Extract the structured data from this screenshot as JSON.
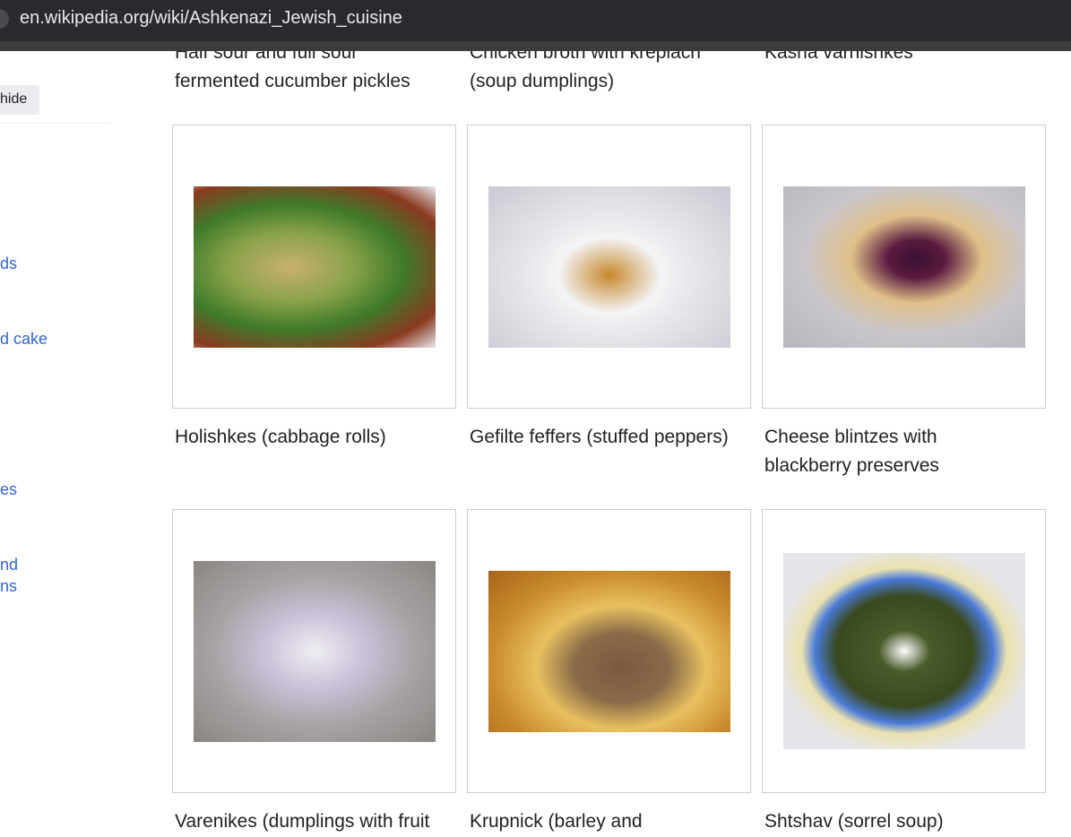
{
  "browser": {
    "url": "en.wikipedia.org/wiki/Ashkenazi_Jewish_cuisine"
  },
  "sidebar": {
    "hide_label": "hide",
    "toc_fragments": [
      "ds",
      "d cake",
      "es",
      "nd",
      "ns"
    ]
  },
  "gallery": [
    {
      "caption_lines": [
        "Half sour and full sour",
        "fermented cucumber pickles"
      ]
    },
    {
      "caption_lines": [
        "Chicken broth with kreplach",
        "(soup dumplings)"
      ]
    },
    {
      "caption_lines": [
        "Kasha varnishkes"
      ]
    },
    {
      "caption_lines": [
        "Holishkes (cabbage rolls)"
      ],
      "image": "cabbage rolls"
    },
    {
      "caption_lines": [
        "Gefilte feffers (stuffed peppers)"
      ],
      "image": "stuffed peppers"
    },
    {
      "caption_lines": [
        "Cheese blintzes with",
        "blackberry preserves"
      ],
      "image": "blintzes"
    },
    {
      "caption_lines": [
        "Varenikes (dumplings with fruit"
      ],
      "image": "dumplings"
    },
    {
      "caption_lines": [
        "Krupnick (barley and"
      ],
      "image": "barley soup"
    },
    {
      "caption_lines": [
        "Shtshav (sorrel soup)"
      ],
      "image": "sorrel soup"
    }
  ]
}
